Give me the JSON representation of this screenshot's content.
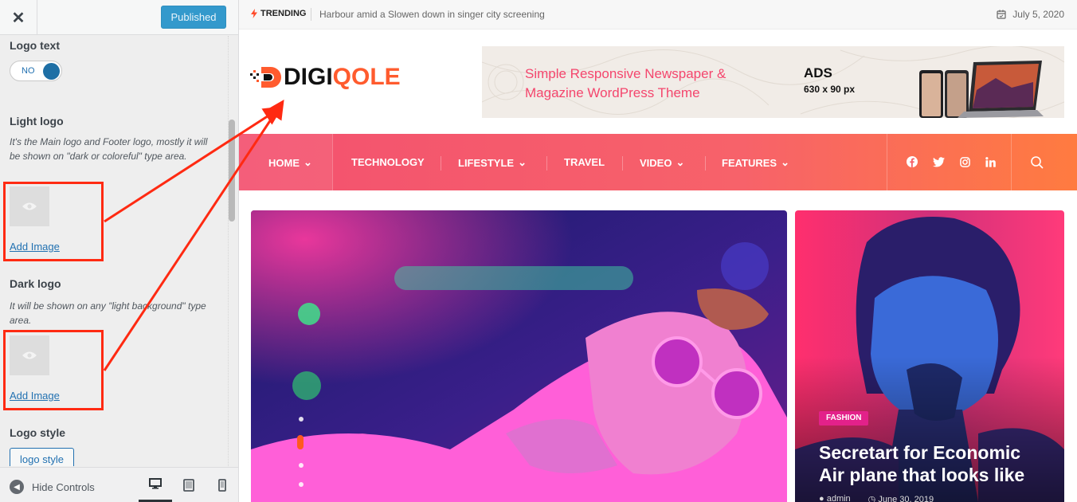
{
  "customizer": {
    "close_label": "✕",
    "publish_label": "Published",
    "logo_text": {
      "title": "Logo text",
      "toggle_label": "NO"
    },
    "light_logo": {
      "title": "Light logo",
      "description": "It's the Main logo and Footer logo, mostly it will be shown on \"dark or coloreful\" type area.",
      "add_label": "Add Image"
    },
    "dark_logo": {
      "title": "Dark logo",
      "description": "It will be shown on any \"light background\" type area.",
      "add_label": "Add Image"
    },
    "logo_style": {
      "title": "Logo style",
      "button_label": "logo style"
    },
    "footer": {
      "hide_label": "Hide Controls",
      "devices": [
        "desktop-icon",
        "tablet-icon",
        "mobile-icon"
      ]
    }
  },
  "site": {
    "trending_label": "TRENDING",
    "trending_text": "Harbour amid a Slowen down in singer city screening",
    "date": "July 5, 2020",
    "logo": {
      "part1": "DIGI",
      "part2": "QOLE"
    },
    "ad": {
      "headline_line1": "Simple Responsive Newspaper &",
      "headline_line2": "Magazine WordPress Theme",
      "title": "ADS",
      "size": "630 x 90 px"
    },
    "nav": {
      "items": [
        {
          "label": "HOME",
          "dropdown": true
        },
        {
          "label": "TECHNOLOGY",
          "dropdown": false
        },
        {
          "label": "LIFESTYLE",
          "dropdown": true
        },
        {
          "label": "TRAVEL",
          "dropdown": false
        },
        {
          "label": "VIDEO",
          "dropdown": true
        },
        {
          "label": "FEATURES",
          "dropdown": true
        }
      ],
      "social": [
        "facebook-icon",
        "twitter-icon",
        "instagram-icon",
        "linkedin-icon"
      ]
    },
    "card": {
      "category": "FASHION",
      "title": "Secretart for Economic Air plane that looks like",
      "author": "admin",
      "date": "June 30, 2019"
    },
    "slider": {
      "dots": 4,
      "active_index": 1
    }
  },
  "colors": {
    "accent": "#ff5b2e",
    "highlight": "#ff2a12",
    "nav_start": "#f3516f",
    "nav_end": "#ff7b40",
    "badge": "#e3218a",
    "link": "#2271b1"
  }
}
